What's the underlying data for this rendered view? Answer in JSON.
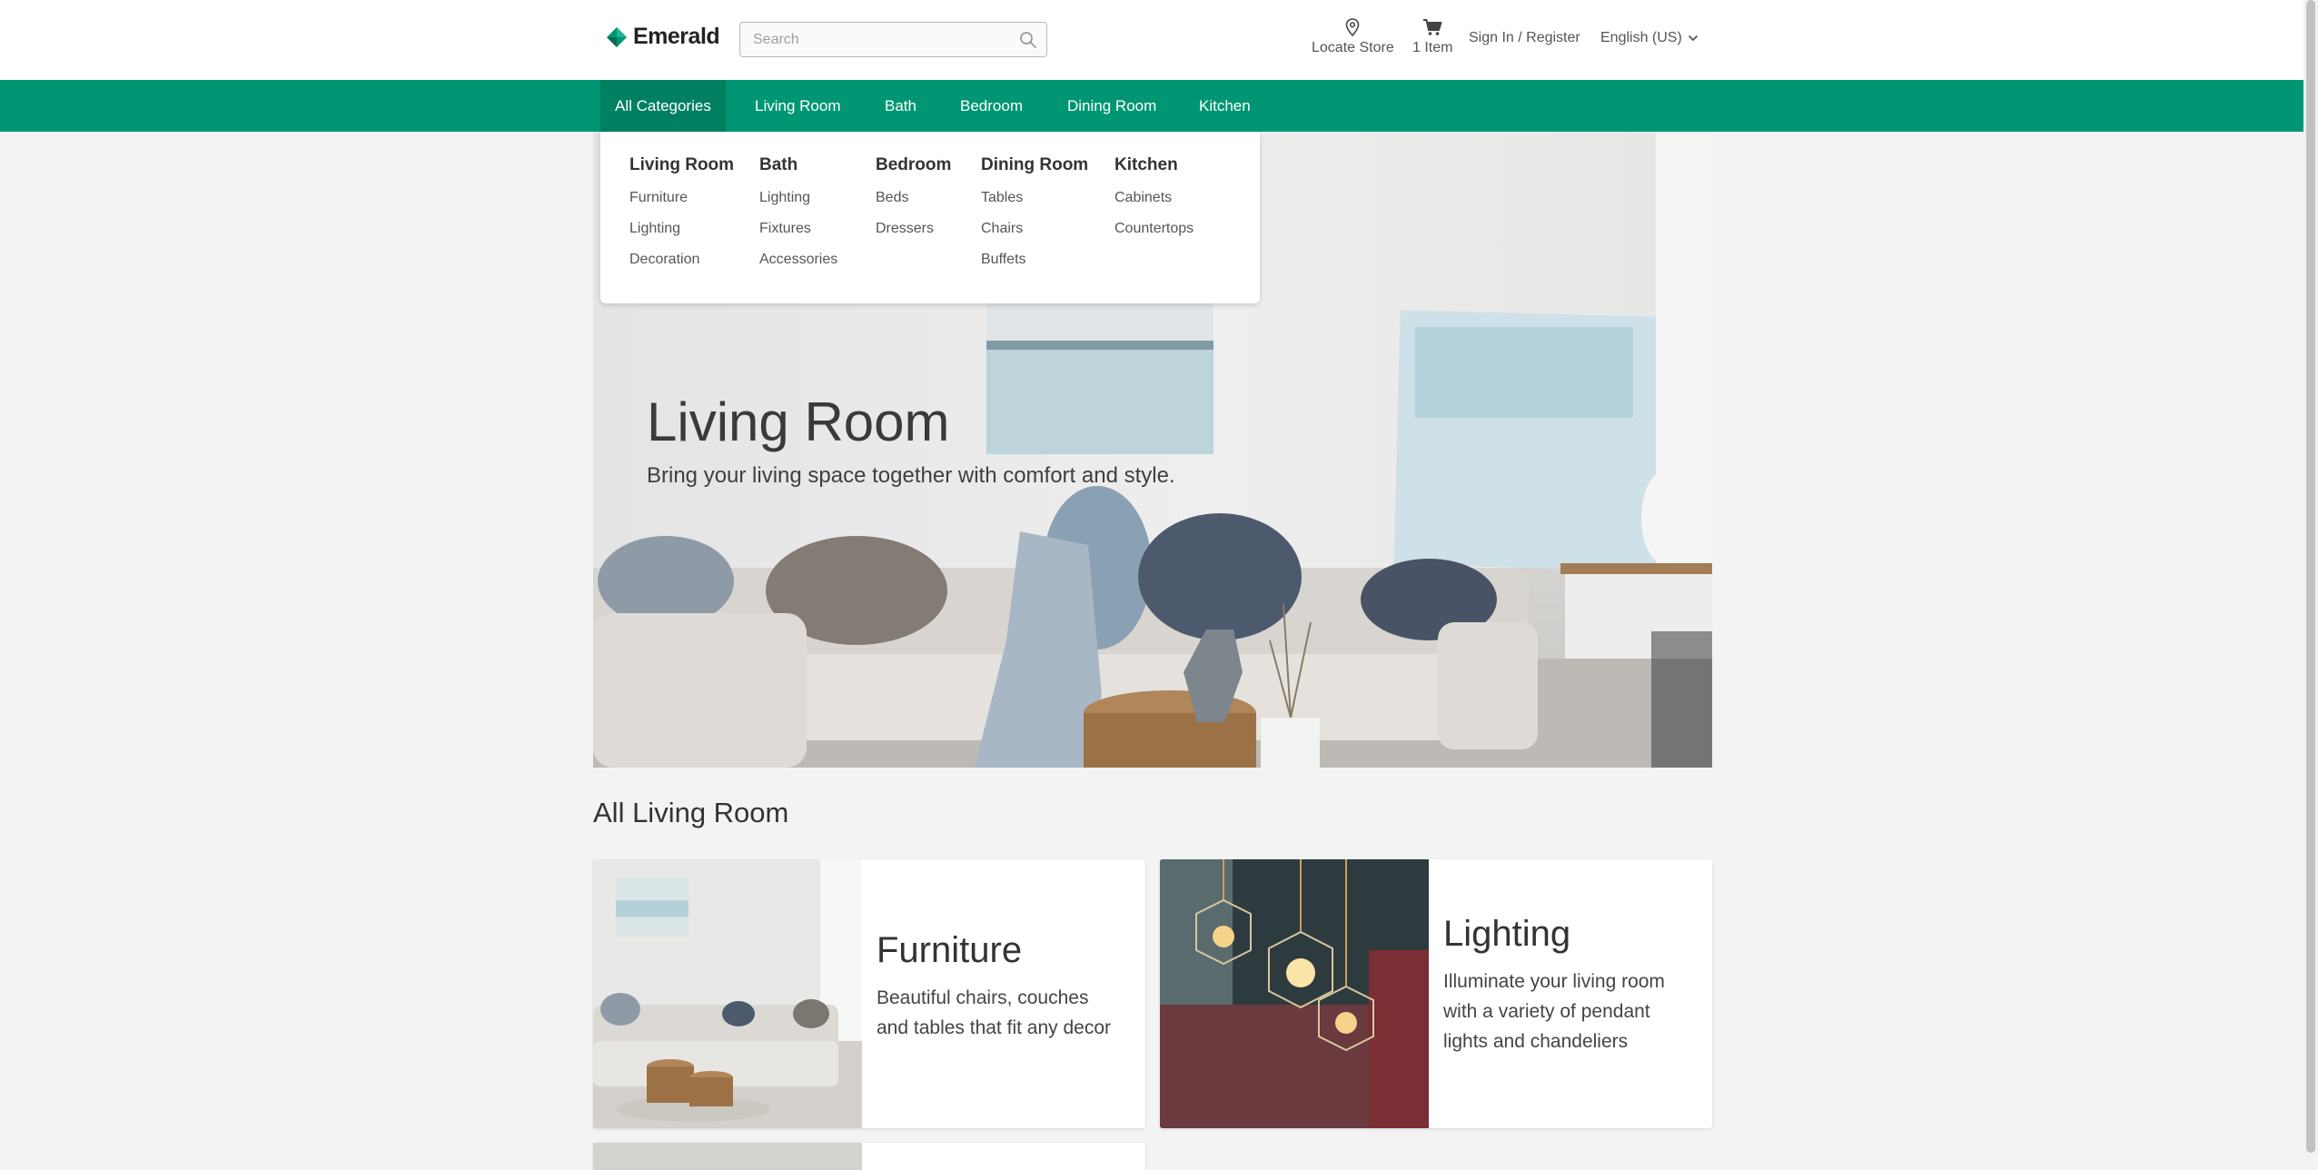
{
  "header": {
    "brand": "Emerald",
    "search_placeholder": "Search",
    "locate_store": "Locate Store",
    "cart_label": "1 Item",
    "sign_in": "Sign In / Register",
    "language": "English (US)"
  },
  "nav": {
    "items": [
      {
        "label": "All Categories",
        "active": true
      },
      {
        "label": "Living Room"
      },
      {
        "label": "Bath"
      },
      {
        "label": "Bedroom"
      },
      {
        "label": "Dining Room"
      },
      {
        "label": "Kitchen"
      }
    ]
  },
  "mega_menu": {
    "columns": [
      {
        "title": "Living Room",
        "links": [
          "Furniture",
          "Lighting",
          "Decoration"
        ]
      },
      {
        "title": "Bath",
        "links": [
          "Lighting",
          "Fixtures",
          "Accessories"
        ]
      },
      {
        "title": "Bedroom",
        "links": [
          "Beds",
          "Dressers"
        ]
      },
      {
        "title": "Dining Room",
        "links": [
          "Tables",
          "Chairs",
          "Buffets"
        ]
      },
      {
        "title": "Kitchen",
        "links": [
          "Cabinets",
          "Countertops"
        ]
      }
    ]
  },
  "hero": {
    "title": "Living Room",
    "subtitle": "Bring your living space together with comfort and style."
  },
  "section": {
    "title": "All Living Room",
    "cards": [
      {
        "title": "Furniture",
        "description": "Beautiful chairs, couches and tables that fit any decor"
      },
      {
        "title": "Lighting",
        "description": "Illuminate your living room with a variety of pendant lights and chandeliers"
      }
    ]
  },
  "colors": {
    "brand_green": "#009673",
    "nav_active": "#007f61",
    "page_background": "#f3f3f3"
  },
  "icons": {
    "logo": "emerald-diamond-icon",
    "search": "search-icon",
    "locate": "location-pin-icon",
    "cart": "cart-icon",
    "language": "chevron-down-icon"
  }
}
